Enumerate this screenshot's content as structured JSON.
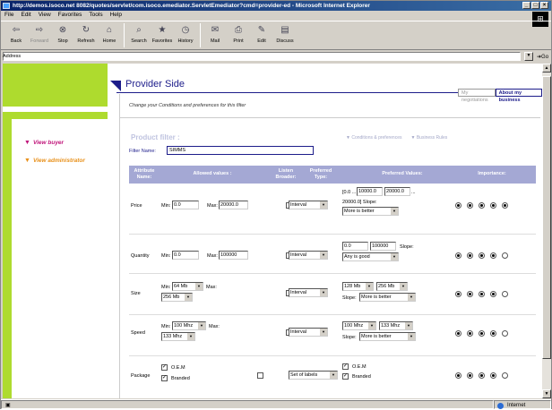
{
  "browser": {
    "title": "http://demos.isoco.net 8082/quotes/servlet/com.isoco.emediator.ServletEmediator?cmd=provider-ed - Microsoft Internet Explorer",
    "menu": [
      "File",
      "Edit",
      "View",
      "Favorites",
      "Tools",
      "Help"
    ],
    "toolbar": [
      {
        "label": "Back",
        "icon": "back-arrow",
        "enabled": true
      },
      {
        "label": "Forward",
        "icon": "forward-arrow",
        "enabled": false
      },
      {
        "label": "Stop",
        "icon": "stop",
        "enabled": true
      },
      {
        "label": "Refresh",
        "icon": "refresh",
        "enabled": true
      },
      {
        "label": "Home",
        "icon": "home",
        "enabled": true
      },
      {
        "label": "Search",
        "icon": "search",
        "enabled": true
      },
      {
        "label": "Favorites",
        "icon": "favorites",
        "enabled": true
      },
      {
        "label": "History",
        "icon": "history",
        "enabled": true
      },
      {
        "label": "Mail",
        "icon": "mail",
        "enabled": true
      },
      {
        "label": "Print",
        "icon": "print",
        "enabled": true
      },
      {
        "label": "Edit",
        "icon": "edit",
        "enabled": true
      },
      {
        "label": "Discuss",
        "icon": "discuss",
        "enabled": true
      }
    ],
    "address_label": "Address",
    "go_label": "Go",
    "status_zone": "Internet"
  },
  "sidebar": {
    "view_buyer": "View buyer",
    "view_admin": "View administrator",
    "colors": {
      "buyer": "#c0157a",
      "admin": "#e8901a",
      "strip": "#aedb2e"
    }
  },
  "header": {
    "title": "Provider Side",
    "tabs": [
      {
        "label": "My negotiations",
        "active": false
      },
      {
        "label": "About my business",
        "active": true
      }
    ],
    "description": "Change your Conditions and preferences for this filter"
  },
  "filter": {
    "title": "Product filter :",
    "link_conditions": "Conditions & preferences",
    "link_rules": "Business Rules",
    "name_label": "Filter Name:",
    "name_value": "SIMMS"
  },
  "table": {
    "headers": {
      "attribute": "Attribute Name:",
      "allowed": "Allowed values :",
      "listen": "Listen Broader:",
      "pref_type": "Preferred Type:",
      "pref_values": "Preferred Values:",
      "importance": "Importance:"
    },
    "rows": {
      "price": {
        "name": "Price",
        "min_label": "Min:",
        "min": "0.0",
        "max_label": "Max:",
        "max": "20000.0",
        "listen": false,
        "type": "Interval",
        "pref1_prefix": "[0.0 ...",
        "pref1a": "10000.0",
        "pref1b": "20000.0",
        "pref1_suffix": "...",
        "pref2_prefix": "20000.0] Slope:",
        "pref_choice": "More is better",
        "importance": [
          true,
          true,
          true,
          true,
          true
        ]
      },
      "quantity": {
        "name": "Quantity",
        "min_label": "Min:",
        "min": "0.0",
        "max_label": "Max:",
        "max": "100000",
        "listen": false,
        "type": "Interval",
        "pref_a": "0.0",
        "pref_b": "100000",
        "slope_label": "Slope:",
        "pref_choice": "Any is good",
        "importance": [
          true,
          true,
          true,
          true,
          false
        ]
      },
      "size": {
        "name": "Size",
        "min_label": "Min:",
        "min": "64 Mb",
        "max_label": "Max:",
        "max": "256 Mb",
        "listen": false,
        "type": "Interval",
        "pref_a": "128 Mb",
        "pref_b": "256 Mb",
        "slope_label": "Slope:",
        "pref_choice": "More is better",
        "importance": [
          true,
          true,
          true,
          true,
          false
        ]
      },
      "speed": {
        "name": "Speed",
        "min_label": "Min:",
        "min": "100 Mhz",
        "max_label": "Max:",
        "max": "133 Mhz",
        "listen": false,
        "type": "Interval",
        "pref_a": "100 Mhz",
        "pref_b": "133 Mhz",
        "slope_label": "Slope:",
        "pref_choice": "More is better",
        "importance": [
          true,
          true,
          true,
          true,
          false
        ]
      },
      "package": {
        "name": "Package",
        "opt1": "O.E.M",
        "opt2": "Branded",
        "opt1_checked": true,
        "opt2_checked": true,
        "listen": false,
        "type": "Set of labels",
        "pref_opt1": "O.E.M",
        "pref_opt2": "Branded",
        "pref_opt1_checked": true,
        "pref_opt2_checked": true,
        "importance": [
          true,
          true,
          true,
          true,
          false
        ]
      }
    }
  },
  "colors": {
    "navy": "#1c1c8a",
    "header_bg": "#a4a8d4",
    "link_muted": "#a4a8c8"
  }
}
